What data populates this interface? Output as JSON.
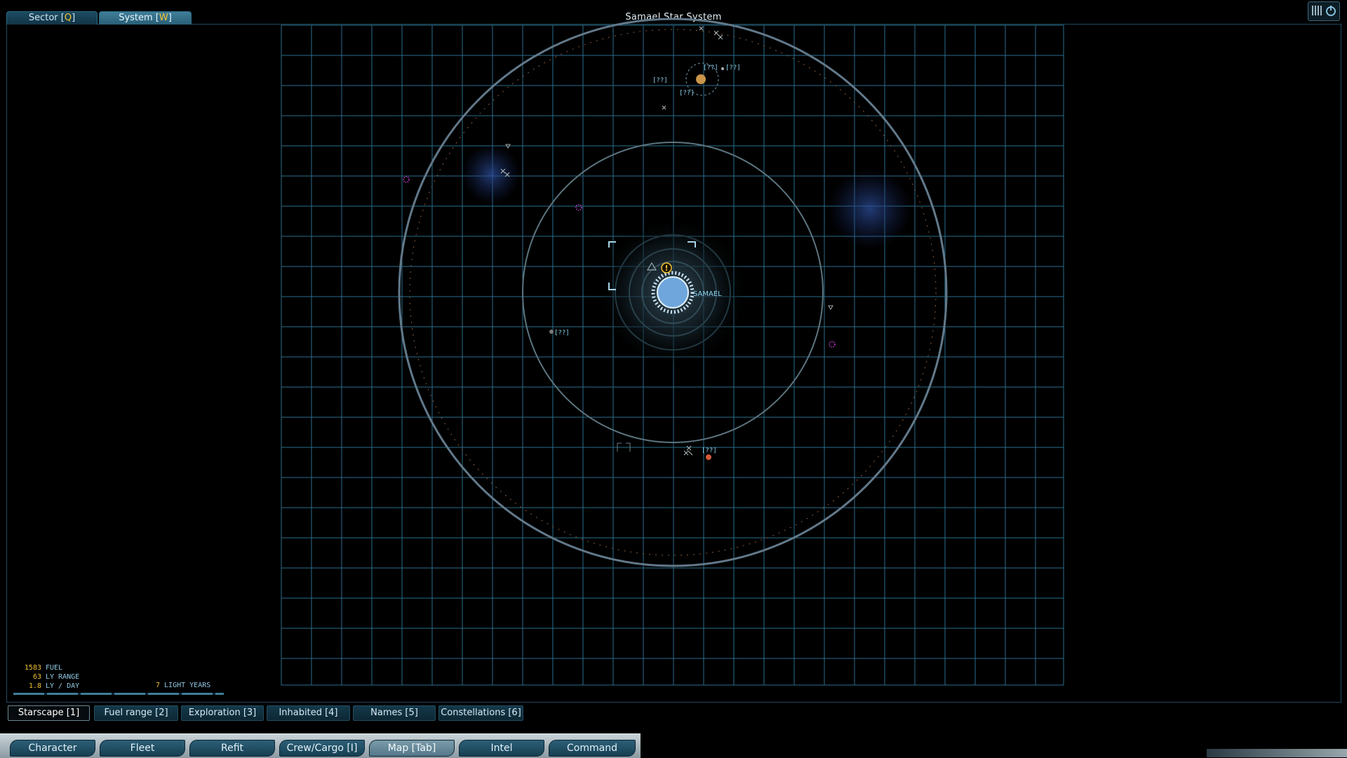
{
  "tabs": [
    {
      "label": "Sector [",
      "key": "Q",
      "tail": "]"
    },
    {
      "label": "System [",
      "key": "W",
      "tail": "]"
    }
  ],
  "map": {
    "title": "Samael Star System",
    "star_label": "SAMAEL",
    "unknown_label": "[??]",
    "unknown_marker_labels": [
      "[??]",
      "[??]",
      "[??]",
      "[??]",
      "[??]",
      "[??]"
    ],
    "alert_symbol": "!",
    "colors": {
      "grid": "#2a6e8c",
      "orbit": "#5c7580",
      "star": "#6fa6dc",
      "label": "#8cd3f0",
      "nebula_marker": "#c33ad1"
    }
  },
  "stats": {
    "fuel_value": "1583",
    "fuel_label": "FUEL",
    "range_value": "63",
    "range_label": "LY RANGE",
    "speed_value": "1.8",
    "speed_label": "LY / DAY",
    "distance_value": "7",
    "distance_label": "LIGHT YEARS"
  },
  "modes": [
    {
      "label": "Starscape [1]"
    },
    {
      "label": "Fuel range [2]"
    },
    {
      "label": "Exploration [3]"
    },
    {
      "label": "Inhabited [4]"
    },
    {
      "label": "Names [5]"
    },
    {
      "label": "Constellations [6]"
    }
  ],
  "bottom_tabs": [
    {
      "label": "Character"
    },
    {
      "label": "Fleet"
    },
    {
      "label": "Refit"
    },
    {
      "label": "Crew/Cargo [I]"
    },
    {
      "label": "Map [Tab]"
    },
    {
      "label": "Intel"
    },
    {
      "label": "Command"
    }
  ],
  "icons": {
    "power": "power-icon",
    "corner": "menu-bars-icon",
    "alert": "alert-icon",
    "warning": "warning-triangle-icon"
  }
}
